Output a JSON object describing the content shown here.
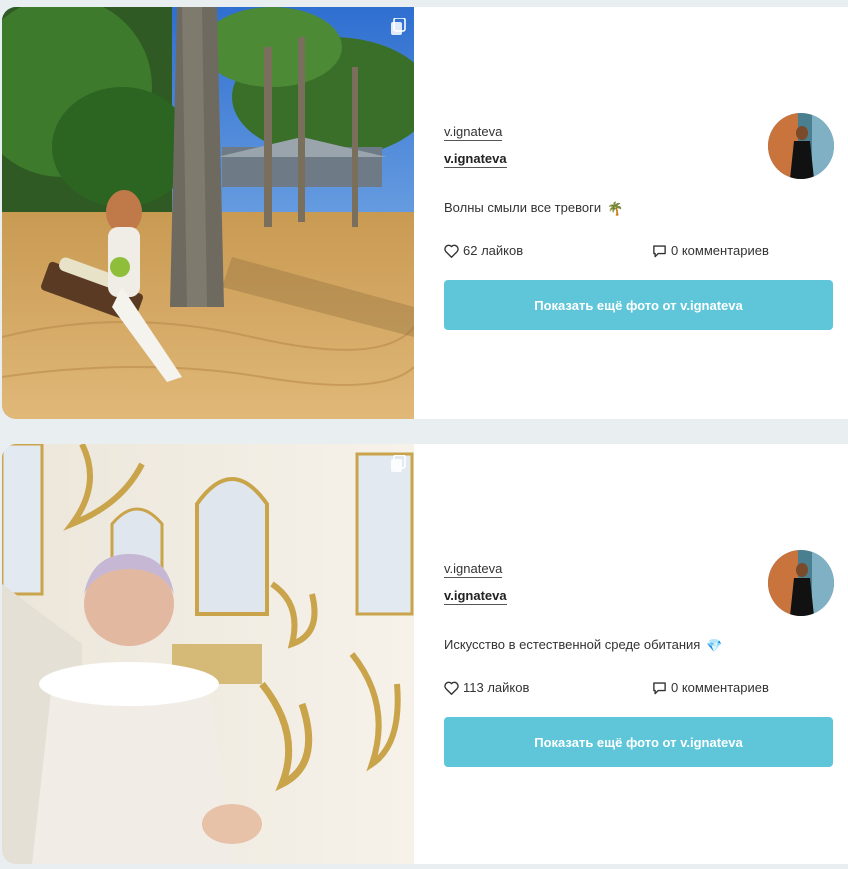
{
  "posts": [
    {
      "photo_icon": "beach-palm-photo",
      "author_top": "v.ignateva",
      "author_bottom": "v.ignateva",
      "caption": "Волны смыли все тревоги",
      "caption_emoji": "🌴",
      "likes": "62 лайков",
      "comments": "0 комментариев",
      "button": "Показать ещё фото от v.ignateva"
    },
    {
      "photo_icon": "palace-interior-photo",
      "author_top": "v.ignateva",
      "author_bottom": "v.ignateva",
      "caption": "Искусство в естественной среде обитания",
      "caption_emoji": "💎",
      "likes": "113 лайков",
      "comments": "0 комментариев",
      "button": "Показать ещё фото от v.ignateva"
    }
  ],
  "colors": {
    "accent_button": "#5fc6d9",
    "page_background": "#e9eef0",
    "card_background": "#ffffff"
  }
}
